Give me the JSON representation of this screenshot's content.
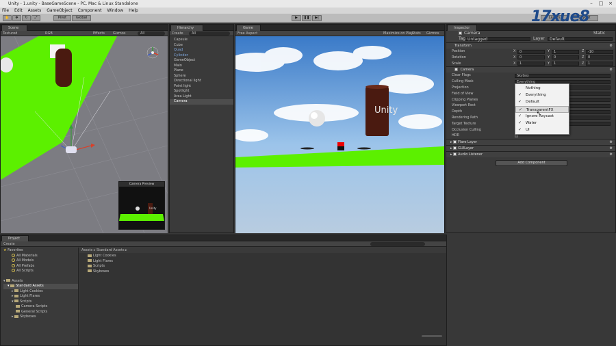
{
  "window": {
    "title": "Unity - 1.unity - BaseGameScene - PC, Mac & Linux Standalone"
  },
  "menu": [
    "File",
    "Edit",
    "Assets",
    "GameObject",
    "Component",
    "Window",
    "Help"
  ],
  "toolbar": {
    "pivot": "Pivot",
    "global": "Global",
    "layers": "Layers",
    "layout": "Layout"
  },
  "scene": {
    "tab": "Scene",
    "mode": "Textured",
    "rgb": "RGB",
    "effects": "Effects",
    "gizmos": "Gizmos",
    "search": "All",
    "preview_title": "Camera Preview"
  },
  "hierarchy": {
    "tab": "Hierarchy",
    "create": "Create",
    "search": "All",
    "items": [
      "Capsule",
      "Cube",
      "Quad",
      "Cylinder",
      "GameObject",
      "Main",
      "Plane",
      "Sphere",
      "Directional light",
      "Point light",
      "Spotlight",
      "Area Light",
      "Camera"
    ]
  },
  "game": {
    "tab": "Game",
    "aspect": "Free Aspect",
    "maximize": "Maximize on Play",
    "stats": "Stats",
    "gizmos": "Gizmos",
    "pillar_text": "Unity"
  },
  "inspector": {
    "tab": "Inspector",
    "object_name": "Camera",
    "static": "Static",
    "tag_label": "Tag",
    "tag_value": "Untagged",
    "layer_label": "Layer",
    "layer_value": "Default",
    "transform": {
      "title": "Transform",
      "rows": [
        {
          "label": "Position",
          "x": "0",
          "y": "1",
          "z": "-10"
        },
        {
          "label": "Rotation",
          "x": "0",
          "y": "0",
          "z": "0"
        },
        {
          "label": "Scale",
          "x": "1",
          "y": "1",
          "z": "1"
        }
      ]
    },
    "camera": {
      "title": "Camera",
      "rows": [
        {
          "label": "Clear Flags",
          "value": "Skybox"
        },
        {
          "label": "Culling Mask",
          "value": "Everything"
        },
        {
          "label": "Projection",
          "value": ""
        },
        {
          "label": "Field of View",
          "value": "60"
        },
        {
          "label": "Clipping Planes",
          "value": ""
        },
        {
          "label": "Viewport Rect",
          "value": ""
        },
        {
          "label": "Depth",
          "value": ""
        },
        {
          "label": "Rendering Path",
          "value": ""
        },
        {
          "label": "Target Texture",
          "value": "None (Render Texture)"
        },
        {
          "label": "Occlusion Culling",
          "value": ""
        },
        {
          "label": "HDR",
          "value": ""
        }
      ]
    },
    "components": [
      "Flare Layer",
      "GUILayer",
      "Audio Listener"
    ],
    "add_component": "Add Component",
    "culling_dropdown": [
      {
        "label": "Nothing",
        "checked": false
      },
      {
        "label": "Everything",
        "checked": true
      },
      {
        "label": "Default",
        "checked": true
      },
      {
        "label": "TransparentFX",
        "checked": true
      },
      {
        "label": "Ignore Raycast",
        "checked": true
      },
      {
        "label": "Water",
        "checked": true
      },
      {
        "label": "UI",
        "checked": true
      }
    ]
  },
  "project": {
    "tab": "Project",
    "create": "Create",
    "favorites_label": "Favorites",
    "favorites": [
      "All Materials",
      "All Models",
      "All Prefabs",
      "All Scripts"
    ],
    "assets_label": "Assets",
    "tree": [
      {
        "label": "Standard Assets",
        "indent": 1
      },
      {
        "label": "Light Cookies",
        "indent": 2
      },
      {
        "label": "Light Flares",
        "indent": 2
      },
      {
        "label": "Scripts",
        "indent": 2
      },
      {
        "label": "Camera Scripts",
        "indent": 3
      },
      {
        "label": "General Scripts",
        "indent": 3
      },
      {
        "label": "Skyboxes",
        "indent": 2
      }
    ],
    "breadcrumb": "Assets ▸ Standard Assets ▸",
    "content": [
      "Light Cookies",
      "Light Flares",
      "Scripts",
      "Skyboxes"
    ]
  },
  "watermark": "17xue8",
  "colors": {
    "ground": "#5cf000",
    "sky": "#8fb8e0",
    "pillar": "#4a1a10"
  }
}
